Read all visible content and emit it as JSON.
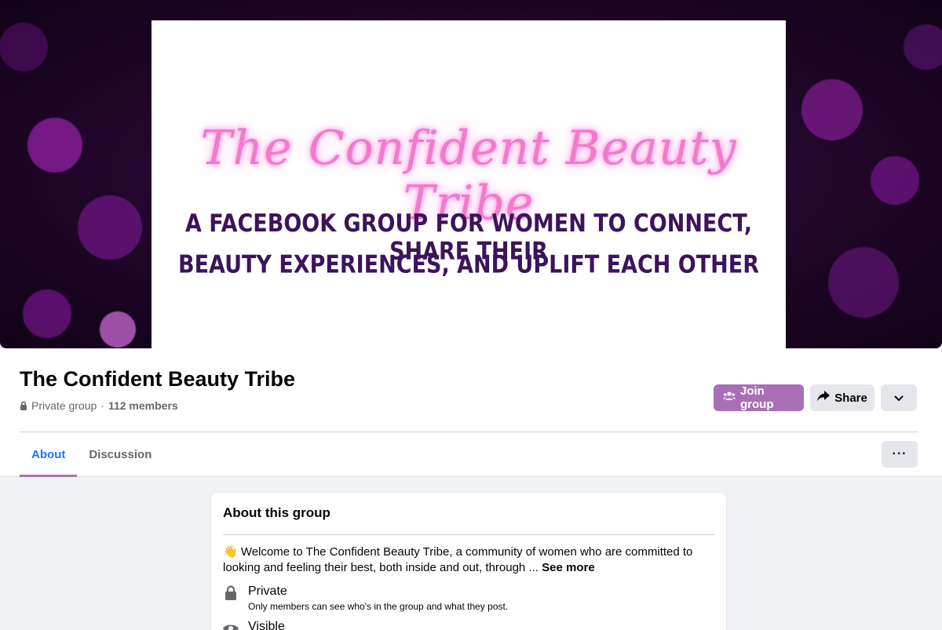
{
  "cover": {
    "script_title": "The Confident Beauty Tribe",
    "line1": "A FACEBOOK GROUP FOR WOMEN TO CONNECT, SHARE THEIR",
    "line2": "BEAUTY EXPERIENCES, AND UPLIFT EACH OTHER"
  },
  "group": {
    "name": "The Confident Beauty Tribe",
    "privacy": "Private group",
    "separator": "·",
    "members": "112 members"
  },
  "actions": {
    "join_label": "Join group",
    "share_label": "Share"
  },
  "tabs": [
    {
      "label": "About",
      "active": true
    },
    {
      "label": "Discussion",
      "active": false
    }
  ],
  "tab_more_label": "···",
  "about": {
    "title": "About this group",
    "emoji": "👋",
    "description": "Welcome to The Confident Beauty Tribe, a community of women who are committed to looking and feeling their best, both inside and out, through ...",
    "see_more": "See more",
    "private_title": "Private",
    "private_sub": "Only members can see who's in the group and what they post.",
    "visible_title": "Visible"
  },
  "colors": {
    "accent": "#a96fb6",
    "link_blue": "#1877f2",
    "cover_pink": "#f27ac9",
    "cover_purple_text": "#3b145b"
  },
  "icons": [
    "lock-icon",
    "members-icon",
    "share-arrow-icon",
    "chevron-down-icon",
    "ellipsis-icon",
    "eye-icon"
  ]
}
